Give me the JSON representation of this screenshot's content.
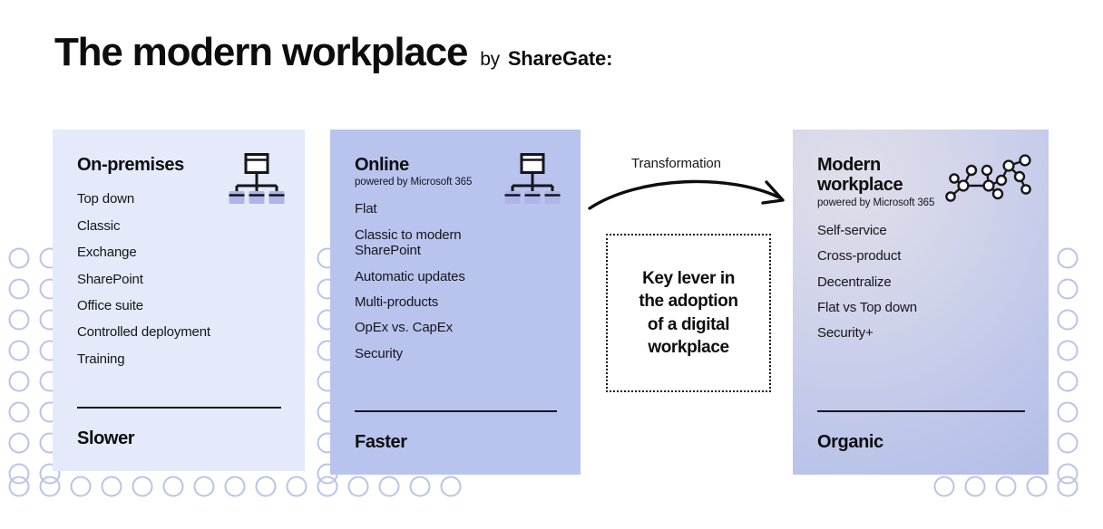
{
  "header": {
    "title": "The modern workplace",
    "by_label": "by",
    "brand": "ShareGate:"
  },
  "colors": {
    "card_onprem_bg": "#e4eaf9",
    "card_online_bg": "#b9c4ee",
    "card_modern_bg_start": "#dfdfea",
    "card_modern_bg_end": "#aeb9e4",
    "dot_stroke": "#b9c3ea",
    "text": "#111111",
    "rule": "#16161c"
  },
  "cards": [
    {
      "id": "on-premises",
      "heading": "On-premises",
      "subtitle": "",
      "icon": "hierarchy-icon",
      "items": [
        "Top down",
        "Classic",
        "Exchange",
        "SharePoint",
        "Office suite",
        "Controlled deployment",
        "Training"
      ],
      "footer_label": "Slower"
    },
    {
      "id": "online",
      "heading": "Online",
      "subtitle": "powered by Microsoft 365",
      "icon": "hierarchy-icon",
      "items": [
        "Flat",
        "Classic to modern SharePoint",
        "Automatic updates",
        "Multi-products",
        "OpEx vs. CapEx",
        "Security"
      ],
      "footer_label": "Faster"
    },
    {
      "id": "modern-workplace",
      "heading": "Modern workplace",
      "subtitle": "powered by Microsoft 365",
      "icon": "network-graph-icon",
      "items": [
        "Self-service",
        "Cross-product",
        "Decentralize",
        "Flat vs Top down",
        "Security+"
      ],
      "footer_label": "Organic"
    }
  ],
  "middle": {
    "transformation_label": "Transformation",
    "arrow": "curved-arrow-right-icon",
    "key_lever_text": "Key lever in\nthe adoption\nof a digital\nworkplace"
  }
}
